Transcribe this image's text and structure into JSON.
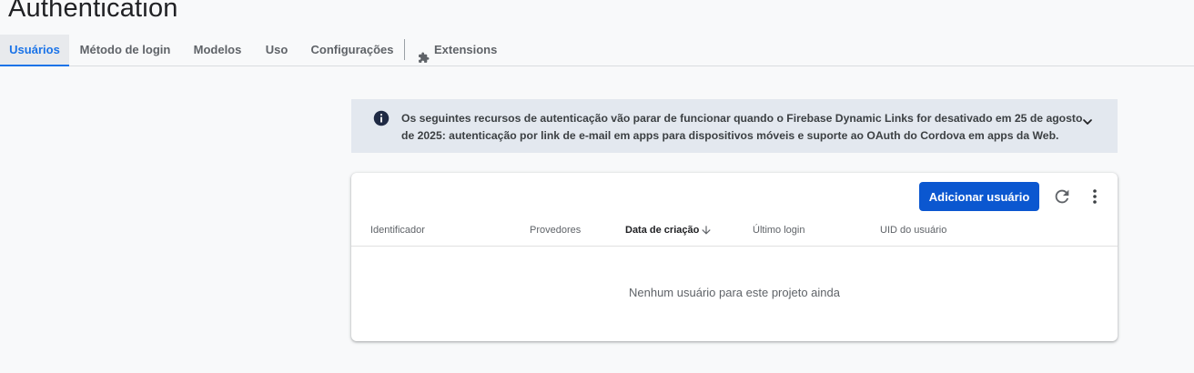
{
  "page": {
    "title": "Authentication"
  },
  "tabs": [
    {
      "label": "Usuários",
      "active": true
    },
    {
      "label": "Método de login",
      "active": false
    },
    {
      "label": "Modelos",
      "active": false
    },
    {
      "label": "Uso",
      "active": false
    },
    {
      "label": "Configurações",
      "active": false
    },
    {
      "label": "Extensions",
      "active": false,
      "icon": "extension-icon"
    }
  ],
  "banner": {
    "icon": "info-icon",
    "text": "Os seguintes recursos de autenticação vão parar de funcionar quando o Firebase Dynamic Links for desativado em 25 de agosto de 2025: autenticação por link de e-mail em apps para dispositivos móveis e suporte ao OAuth do Cordova em apps da Web.",
    "expand_icon": "chevron-down-icon"
  },
  "toolbar": {
    "add_user_label": "Adicionar usuário",
    "refresh_icon": "refresh-icon",
    "more_icon": "more-vert-icon"
  },
  "table": {
    "columns": [
      "Identificador",
      "Provedores",
      "Data de criação",
      "Último login",
      "UID do usuário"
    ],
    "sorted_column": "Data de criação",
    "sort_direction": "descending",
    "empty_message": "Nenhum usuário para este projeto ainda"
  },
  "colors": {
    "accent": "#1a73e8",
    "primary_button": "#0b57d0",
    "banner_bg": "#e3e8ef"
  }
}
